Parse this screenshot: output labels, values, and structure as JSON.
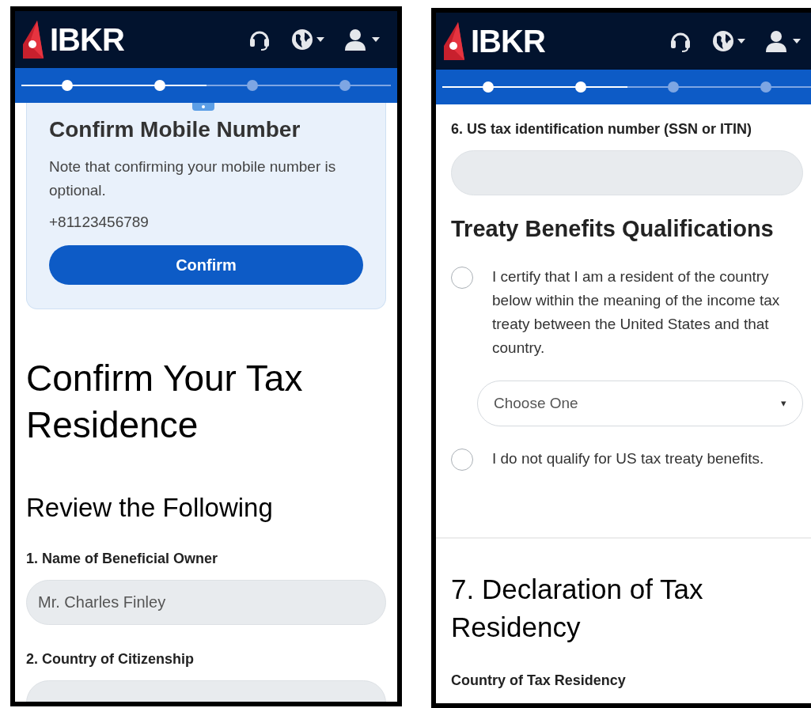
{
  "screens": [
    {
      "logo": "IBKR",
      "progress": {
        "level": 0.5,
        "steps": [
          {
            "done": true
          },
          {
            "done": true
          },
          {
            "done": false
          },
          {
            "done": false
          }
        ]
      },
      "blocks": [
        {
          "kind": "card",
          "title": "Confirm Mobile Number",
          "note": "Note that confirming your mobile number is optional.",
          "phone": "+81123456789",
          "button": "Confirm"
        },
        {
          "kind": "page_title",
          "text": "Confirm Your Tax Residence"
        },
        {
          "kind": "heading",
          "text": "Review the Following"
        },
        {
          "kind": "label",
          "text": "1. Name of Beneficial Owner"
        },
        {
          "kind": "field",
          "value": "Mr. Charles Finley"
        },
        {
          "kind": "label",
          "text": "2. Country of Citizenship"
        },
        {
          "kind": "field"
        }
      ]
    },
    {
      "logo": "IBKR",
      "progress": {
        "level": 0.5,
        "steps": [
          {
            "done": true
          },
          {
            "done": true
          },
          {
            "done": false
          },
          {
            "done": false
          }
        ]
      },
      "blocks": [
        {
          "kind": "label",
          "text": "6. US tax identification number (SSN or ITIN)"
        },
        {
          "kind": "field"
        },
        {
          "kind": "subheading",
          "text": "Treaty Benefits Qualifications"
        },
        {
          "kind": "radio",
          "text": "I certify that I am a resident of the country below within the meaning of the income tax treaty between the United States and that country.",
          "selected": false
        },
        {
          "kind": "select",
          "placeholder": "Choose One",
          "caret": "▾"
        },
        {
          "kind": "radio",
          "text": "I do not qualify for US tax treaty benefits.",
          "selected": false
        },
        {
          "kind": "divider"
        },
        {
          "kind": "section_title",
          "text": "7. Declaration of Tax Residency"
        },
        {
          "kind": "label",
          "text": "Country of Tax Residency"
        }
      ]
    }
  ]
}
